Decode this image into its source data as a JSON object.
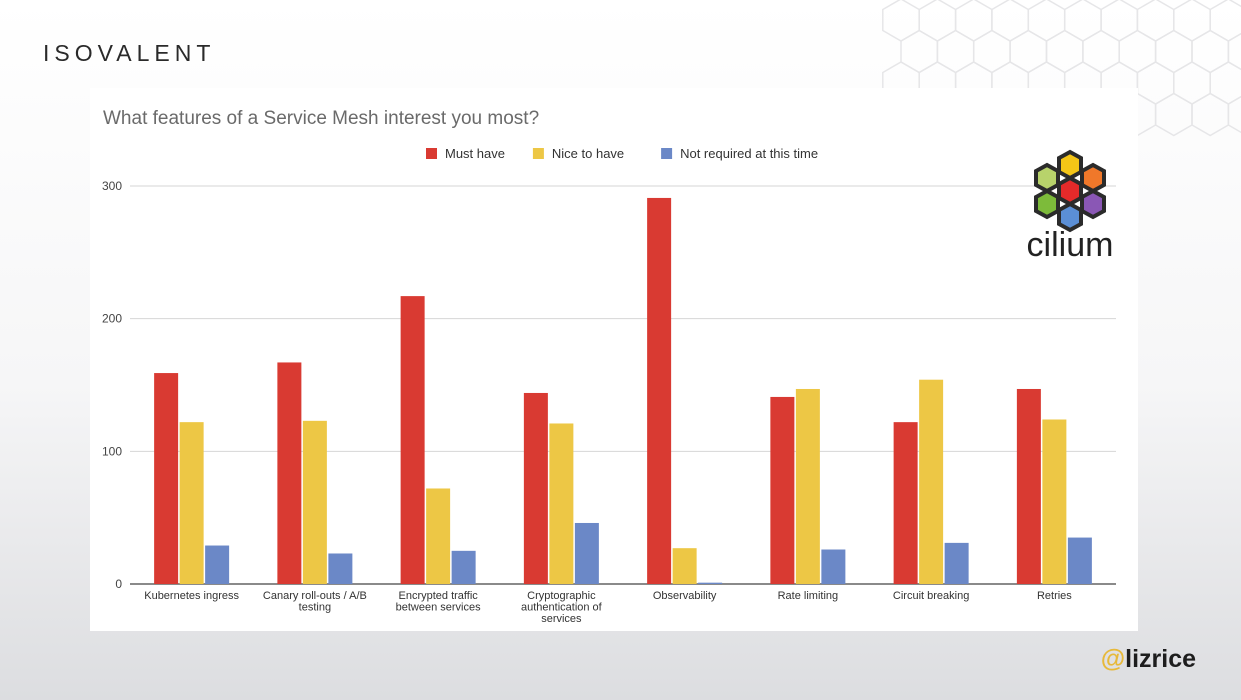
{
  "brand": {
    "company": "ISOVALENT",
    "handle_prefix": "@",
    "handle": "lizrice",
    "logo_word": "cilium"
  },
  "colors": {
    "must_have": "#d93a32",
    "nice_to_have": "#edc745",
    "not_required": "#6b88c7"
  },
  "chart_data": {
    "type": "bar",
    "title": "What features of a Service Mesh interest you most?",
    "xlabel": "",
    "ylabel": "",
    "ylim": [
      0,
      300
    ],
    "yticks": [
      0,
      100,
      200,
      300
    ],
    "grid": true,
    "legend_position": "top-center",
    "categories": [
      [
        "Kubernetes ingress"
      ],
      [
        "Canary roll-outs / A/B",
        "testing"
      ],
      [
        "Encrypted traffic",
        "between services"
      ],
      [
        "Cryptographic",
        "authentication of",
        "services"
      ],
      [
        "Observability"
      ],
      [
        "Rate limiting"
      ],
      [
        "Circuit breaking"
      ],
      [
        "Retries"
      ]
    ],
    "series": [
      {
        "name": "Must have",
        "color": "#d93a32",
        "values": [
          159,
          167,
          217,
          144,
          291,
          141,
          122,
          147
        ]
      },
      {
        "name": "Nice to have",
        "color": "#edc745",
        "values": [
          122,
          123,
          72,
          121,
          27,
          147,
          154,
          124
        ]
      },
      {
        "name": "Not required at this time",
        "color": "#6b88c7",
        "values": [
          29,
          23,
          25,
          46,
          1,
          26,
          31,
          35
        ]
      }
    ]
  }
}
